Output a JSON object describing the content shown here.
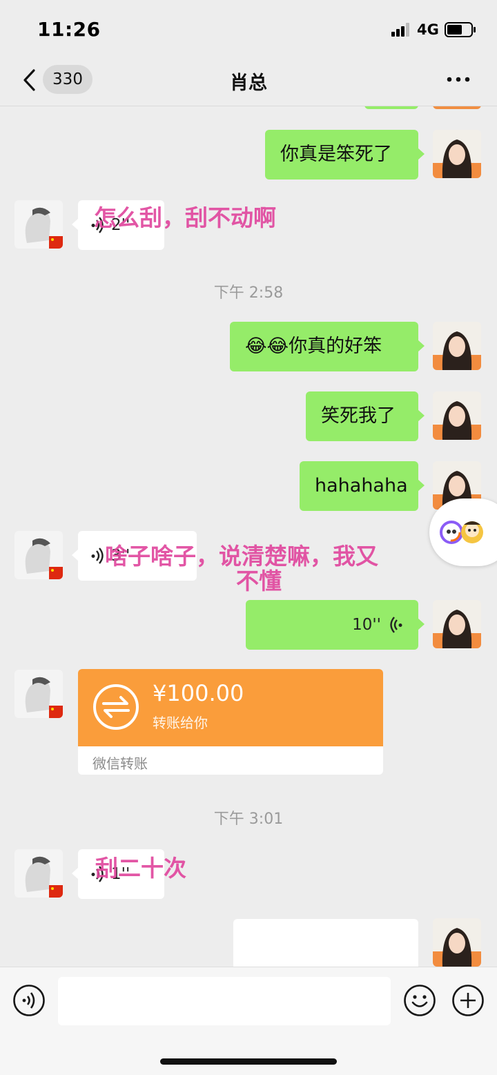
{
  "status_bar": {
    "time": "11:26",
    "network": "4G"
  },
  "nav": {
    "unread_count": "330",
    "title": "肖总"
  },
  "messages": {
    "m1_out": "你真是笨死了",
    "m2_in_voice": "2''",
    "m2_overlay": "怎么刮，刮不动啊",
    "ts1": "下午 2:58",
    "m3_out_emoji": "😂😂",
    "m3_out_text": "你真的好笨",
    "m4_out": "笑死我了",
    "m5_out": "hahahaha",
    "m6_in_voice": "3''",
    "m6_overlay_line1": "啥子啥子，说清楚嘛，我又",
    "m6_overlay_line2": "不懂",
    "m7_out_voice": "10''",
    "transfer_amount": "¥100.00",
    "transfer_note": "转账给你",
    "transfer_footer": "微信转账",
    "ts2": "下午 3:01",
    "m8_in_voice": "1''",
    "m8_overlay": "刮二十次"
  },
  "input_bar": {
    "placeholder": ""
  },
  "colors": {
    "out_bubble": "#95ec69",
    "transfer": "#fa9d3b",
    "overlay_text": "#e0489e",
    "background": "#ededed"
  }
}
